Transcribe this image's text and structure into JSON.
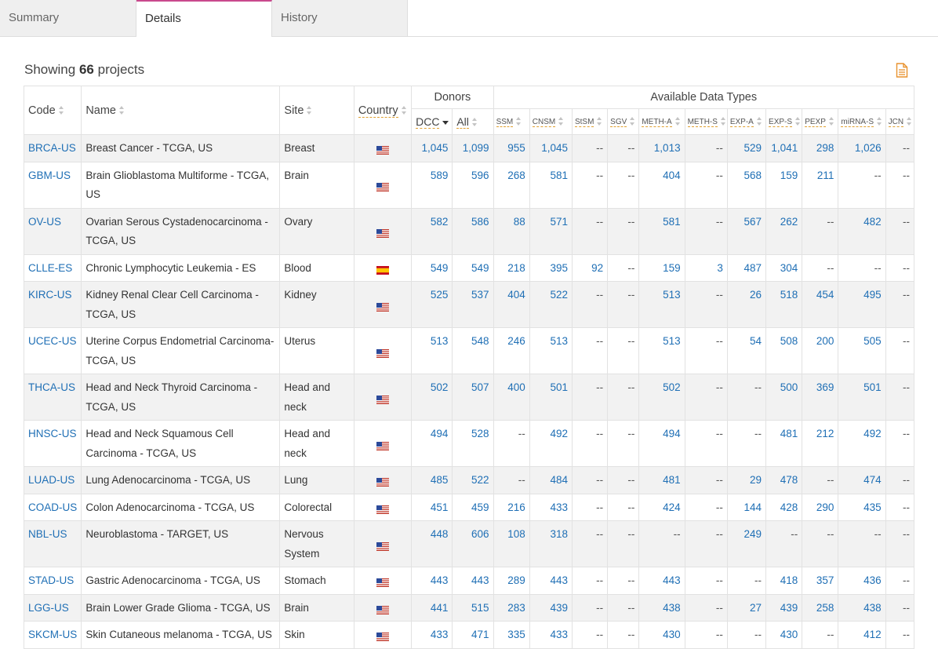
{
  "tabs": [
    {
      "label": "Summary"
    },
    {
      "label": "Details"
    },
    {
      "label": "History"
    }
  ],
  "summary": {
    "prefix": "Showing",
    "count": "66",
    "suffix": "projects"
  },
  "table": {
    "group_headers": {
      "donors": "Donors",
      "data_types": "Available Data Types"
    },
    "columns": {
      "code": "Code",
      "name": "Name",
      "site": "Site",
      "country": "Country"
    },
    "donor_columns": {
      "dcc": "DCC",
      "all": "All"
    },
    "data_types": [
      "SSM",
      "CNSM",
      "StSM",
      "SGV",
      "METH-A",
      "METH-S",
      "EXP-A",
      "EXP-S",
      "PEXP",
      "miRNA-S",
      "JCN"
    ],
    "rows": [
      {
        "code": "BRCA-US",
        "name": "Breast Cancer - TCGA, US",
        "site": "Breast",
        "flag": "US",
        "dcc": "1,045",
        "all": "1,099",
        "values": [
          "955",
          "1,045",
          "--",
          "--",
          "1,013",
          "--",
          "529",
          "1,041",
          "298",
          "1,026",
          "--"
        ]
      },
      {
        "code": "GBM-US",
        "name": "Brain Glioblastoma Multiforme - TCGA, US",
        "site": "Brain",
        "flag": "US",
        "dcc": "589",
        "all": "596",
        "values": [
          "268",
          "581",
          "--",
          "--",
          "404",
          "--",
          "568",
          "159",
          "211",
          "--",
          "--"
        ]
      },
      {
        "code": "OV-US",
        "name": "Ovarian Serous Cystadenocarcinoma - TCGA, US",
        "site": "Ovary",
        "flag": "US",
        "dcc": "582",
        "all": "586",
        "values": [
          "88",
          "571",
          "--",
          "--",
          "581",
          "--",
          "567",
          "262",
          "--",
          "482",
          "--"
        ]
      },
      {
        "code": "CLLE-ES",
        "name": "Chronic Lymphocytic Leukemia - ES",
        "site": "Blood",
        "flag": "ES",
        "dcc": "549",
        "all": "549",
        "values": [
          "218",
          "395",
          "92",
          "--",
          "159",
          "3",
          "487",
          "304",
          "--",
          "--",
          "--"
        ]
      },
      {
        "code": "KIRC-US",
        "name": "Kidney Renal Clear Cell Carcinoma - TCGA, US",
        "site": "Kidney",
        "flag": "US",
        "dcc": "525",
        "all": "537",
        "values": [
          "404",
          "522",
          "--",
          "--",
          "513",
          "--",
          "26",
          "518",
          "454",
          "495",
          "--"
        ]
      },
      {
        "code": "UCEC-US",
        "name": "Uterine Corpus Endometrial Carcinoma- TCGA, US",
        "site": "Uterus",
        "flag": "US",
        "dcc": "513",
        "all": "548",
        "values": [
          "246",
          "513",
          "--",
          "--",
          "513",
          "--",
          "54",
          "508",
          "200",
          "505",
          "--"
        ]
      },
      {
        "code": "THCA-US",
        "name": "Head and Neck Thyroid Carcinoma - TCGA, US",
        "site": "Head and neck",
        "flag": "US",
        "dcc": "502",
        "all": "507",
        "values": [
          "400",
          "501",
          "--",
          "--",
          "502",
          "--",
          "--",
          "500",
          "369",
          "501",
          "--"
        ]
      },
      {
        "code": "HNSC-US",
        "name": "Head and Neck Squamous Cell Carcinoma - TCGA, US",
        "site": "Head and neck",
        "flag": "US",
        "dcc": "494",
        "all": "528",
        "values": [
          "--",
          "492",
          "--",
          "--",
          "494",
          "--",
          "--",
          "481",
          "212",
          "492",
          "--"
        ]
      },
      {
        "code": "LUAD-US",
        "name": "Lung Adenocarcinoma - TCGA, US",
        "site": "Lung",
        "flag": "US",
        "dcc": "485",
        "all": "522",
        "values": [
          "--",
          "484",
          "--",
          "--",
          "481",
          "--",
          "29",
          "478",
          "--",
          "474",
          "--"
        ]
      },
      {
        "code": "COAD-US",
        "name": "Colon Adenocarcinoma - TCGA, US",
        "site": "Colorectal",
        "flag": "US",
        "dcc": "451",
        "all": "459",
        "values": [
          "216",
          "433",
          "--",
          "--",
          "424",
          "--",
          "144",
          "428",
          "290",
          "435",
          "--"
        ]
      },
      {
        "code": "NBL-US",
        "name": "Neuroblastoma - TARGET, US",
        "site": "Nervous System",
        "flag": "US",
        "dcc": "448",
        "all": "606",
        "values": [
          "108",
          "318",
          "--",
          "--",
          "--",
          "--",
          "249",
          "--",
          "--",
          "--",
          "--"
        ]
      },
      {
        "code": "STAD-US",
        "name": "Gastric Adenocarcinoma - TCGA, US",
        "site": "Stomach",
        "flag": "US",
        "dcc": "443",
        "all": "443",
        "values": [
          "289",
          "443",
          "--",
          "--",
          "443",
          "--",
          "--",
          "418",
          "357",
          "436",
          "--"
        ]
      },
      {
        "code": "LGG-US",
        "name": "Brain Lower Grade Glioma - TCGA, US",
        "site": "Brain",
        "flag": "US",
        "dcc": "441",
        "all": "515",
        "values": [
          "283",
          "439",
          "--",
          "--",
          "438",
          "--",
          "27",
          "439",
          "258",
          "438",
          "--"
        ]
      },
      {
        "code": "SKCM-US",
        "name": "Skin Cutaneous melanoma - TCGA, US",
        "site": "Skin",
        "flag": "US",
        "dcc": "433",
        "all": "471",
        "values": [
          "335",
          "433",
          "--",
          "--",
          "430",
          "--",
          "--",
          "430",
          "--",
          "412",
          "--"
        ]
      }
    ]
  },
  "colors": {
    "link": "#1f6fb5",
    "accent": "#c9498d",
    "export_icon": "#e8922e",
    "stripe": "#f2f2f2"
  },
  "icons": {
    "export": "file-export-icon",
    "sort": "sort-arrows-icon",
    "us_flag": "us-flag-icon",
    "es_flag": "spain-flag-icon"
  }
}
